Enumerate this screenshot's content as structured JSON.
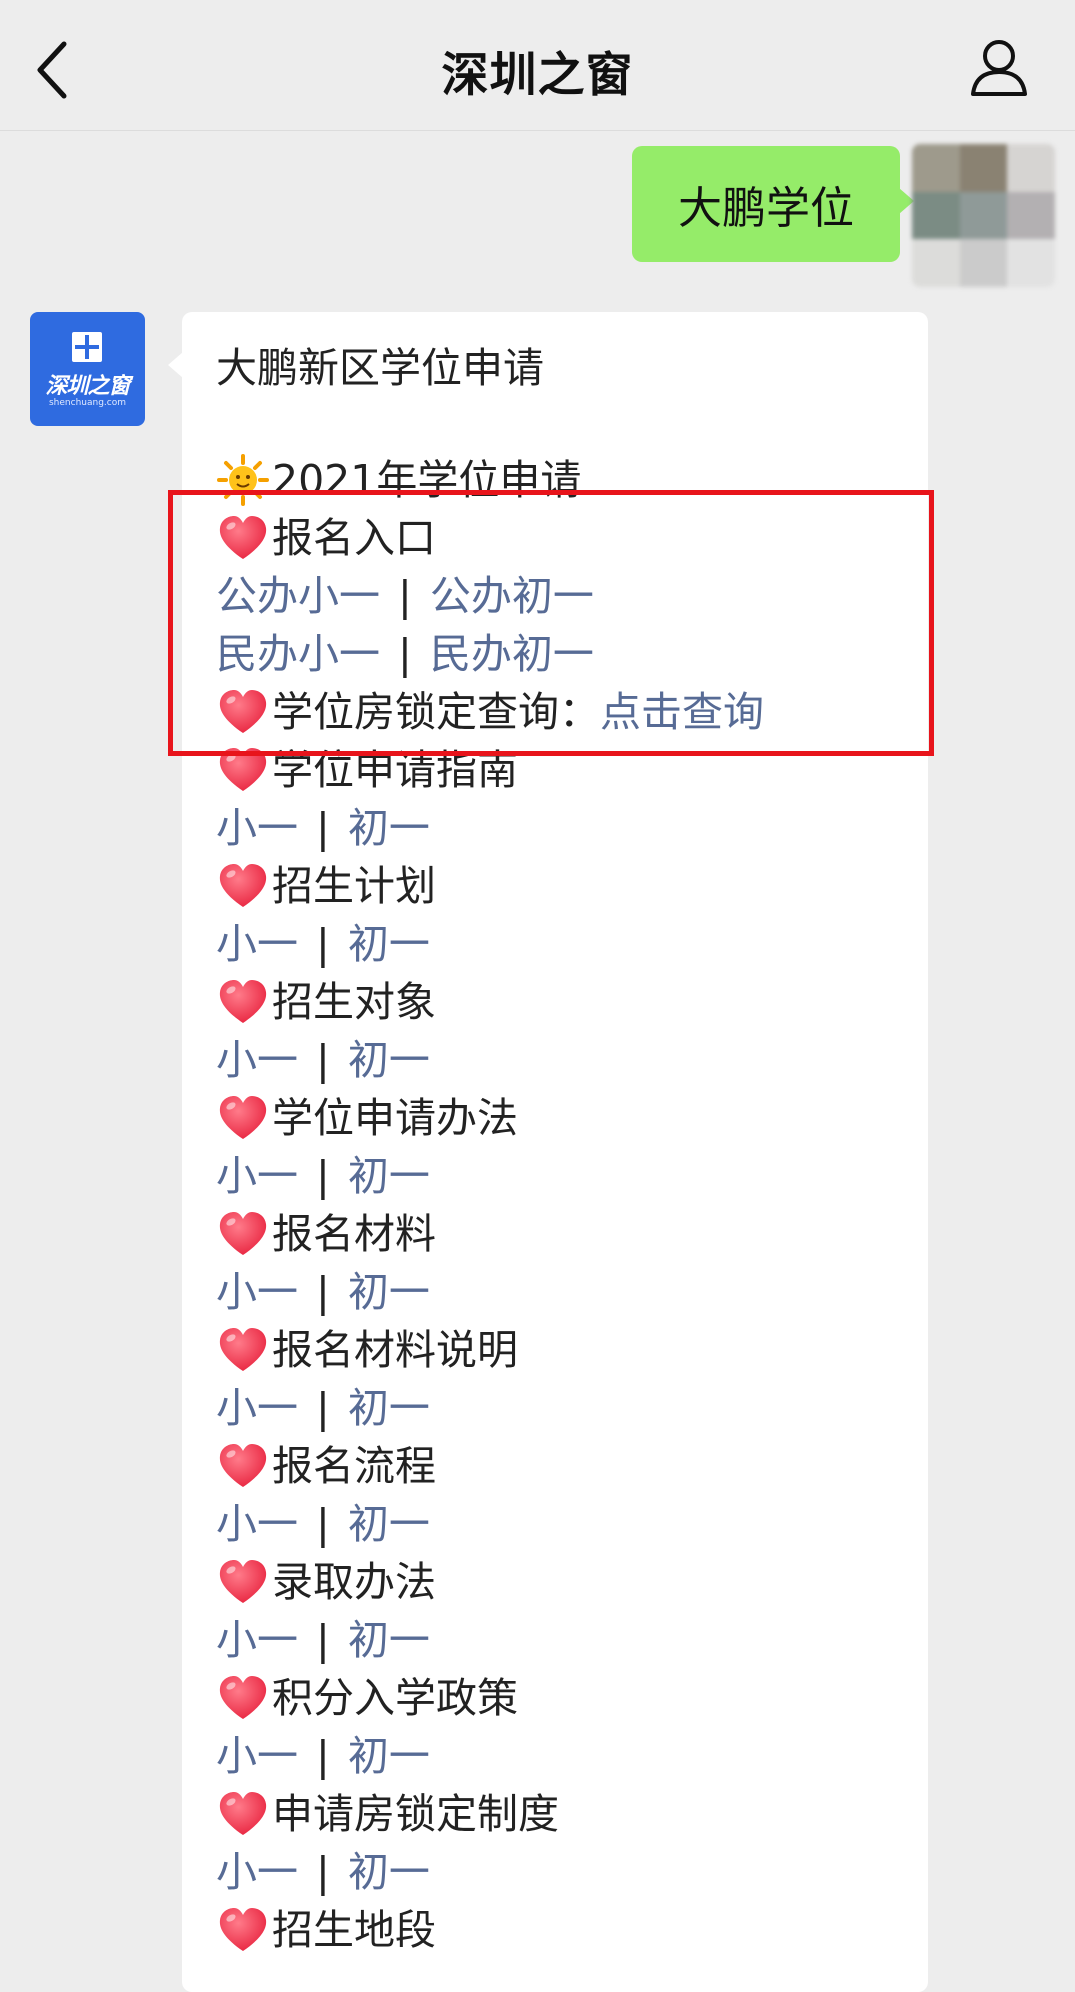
{
  "header": {
    "title": "深圳之窗"
  },
  "outgoing": {
    "text": "大鹏学位"
  },
  "account": {
    "brand": "深圳之窗",
    "url": "shenchuang.com"
  },
  "message": {
    "heading": "大鹏新区学位申请",
    "year_line": "2021年学位申请",
    "sections": [
      {
        "title": "报名入口",
        "links": [
          [
            "公办小一",
            "公办初一"
          ],
          [
            "民办小一",
            "民办初一"
          ]
        ]
      },
      {
        "title": "学位房锁定查询：",
        "inline_link": "点击查询"
      },
      {
        "title": "学位申请指南",
        "links": [
          [
            "小一",
            "初一"
          ]
        ]
      },
      {
        "title": "招生计划",
        "links": [
          [
            "小一",
            "初一"
          ]
        ]
      },
      {
        "title": "招生对象",
        "links": [
          [
            "小一",
            "初一"
          ]
        ]
      },
      {
        "title": "学位申请办法",
        "links": [
          [
            "小一",
            "初一"
          ]
        ]
      },
      {
        "title": "报名材料",
        "links": [
          [
            "小一",
            "初一"
          ]
        ]
      },
      {
        "title": "报名材料说明",
        "links": [
          [
            "小一",
            "初一"
          ]
        ]
      },
      {
        "title": "报名流程",
        "links": [
          [
            "小一",
            "初一"
          ]
        ]
      },
      {
        "title": "录取办法",
        "links": [
          [
            "小一",
            "初一"
          ]
        ]
      },
      {
        "title": "积分入学政策",
        "links": [
          [
            "小一",
            "初一"
          ]
        ]
      },
      {
        "title": "申请房锁定制度",
        "links": [
          [
            "小一",
            "初一"
          ]
        ]
      },
      {
        "title": "招生地段"
      }
    ],
    "separator": "|"
  },
  "colors": {
    "link": "#576b95",
    "highlight": "#e8141b",
    "bubble_out": "#95ec69"
  },
  "icons": {
    "back": "chevron-left-icon",
    "profile": "person-icon",
    "heart": "heart-icon",
    "sun": "sun-icon"
  }
}
